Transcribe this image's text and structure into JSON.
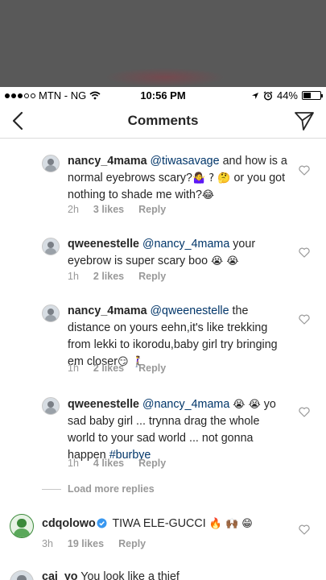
{
  "status_bar": {
    "carrier": "MTN - NG",
    "time": "10:56 PM",
    "battery": "44%",
    "battery_fraction": 0.44,
    "icons": [
      "signal-dots",
      "wifi-icon",
      "location-arrow-icon",
      "alarm-icon",
      "battery-icon"
    ]
  },
  "nav": {
    "title": "Comments",
    "back_icon": "chevron-left-icon",
    "send_icon": "direct-send-icon"
  },
  "comments": [
    {
      "username": "nancy_4mama",
      "mention": "@tiwasavage",
      "text": "and how is a normal eyebrows scary?",
      "emoji_tail": "🤷‍♀️ ? 🤔",
      "text2": "or you got nothing to shade me with?",
      "emoji_end": "😂",
      "time": "2h",
      "likes": "3 likes",
      "reply": "Reply"
    },
    {
      "username": "qweenestelle",
      "mention": "@nancy_4mama",
      "text": "your eyebrow is super  scary boo",
      "emoji_end": "😭 😭",
      "time": "1h",
      "likes": "2 likes",
      "reply": "Reply"
    },
    {
      "username": "nancy_4mama",
      "mention": "@qweenestelle",
      "text": "the distance on yours eehn,it's like trekking from lekki to ikorodu,baby girl try bringing em closer",
      "emoji_end": "😏 🚶‍♀️",
      "time": "1h",
      "likes": "2 likes",
      "reply": "Reply"
    },
    {
      "username": "qweenestelle",
      "mention": "@nancy_4mama",
      "emoji_mid": "😭 😭",
      "text": "yo sad baby girl ... trynna drag the whole world to your sad world ... not gonna happen",
      "hashtag": "#burbye",
      "time": "1h",
      "likes": "4 likes",
      "reply": "Reply"
    }
  ],
  "load_more": "Load more replies",
  "top_comment": {
    "username": "cdqolowo",
    "text": "TIWA ELE-GUCCI",
    "emoji_end": "🔥 🙌🏾 😁",
    "time": "3h",
    "likes": "19 likes",
    "reply": "Reply"
  },
  "partial_comment": {
    "username": "cai_yo",
    "text": "You look like a thief"
  }
}
